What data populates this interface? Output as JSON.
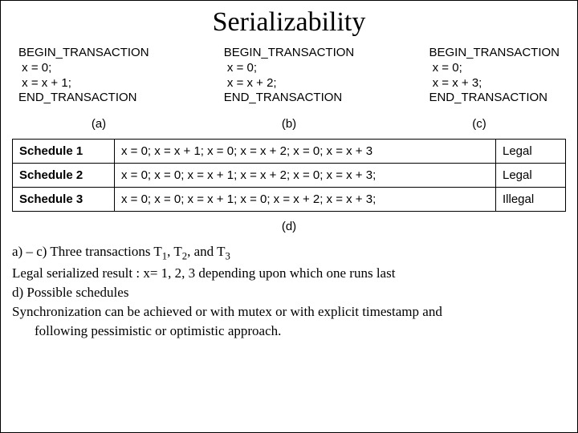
{
  "title": "Serializability",
  "transactions": {
    "a": "BEGIN_TRANSACTION\n x = 0;\n x = x + 1;\nEND_TRANSACTION",
    "b": "BEGIN_TRANSACTION\n x = 0;\n x = x + 2;\nEND_TRANSACTION",
    "c": "BEGIN_TRANSACTION\n x = 0;\n x = x + 3;\nEND_TRANSACTION"
  },
  "labels": {
    "a": "(a)",
    "b": "(b)",
    "c": "(c)",
    "d": "(d)"
  },
  "schedules": [
    {
      "name": "Schedule 1",
      "ops": "x = 0;  x = x + 1;  x = 0;  x = x + 2;  x = 0;  x = x + 3",
      "verdict": "Legal"
    },
    {
      "name": "Schedule 2",
      "ops": "x = 0;   x = 0;  x = x + 1;  x = x + 2;  x = 0;  x = x + 3;",
      "verdict": "Legal"
    },
    {
      "name": "Schedule 3",
      "ops": "x = 0;  x = 0;  x = x + 1;  x = 0;  x = x + 2;  x = x + 3;",
      "verdict": "Illegal"
    }
  ],
  "notes": {
    "line1_pre": "a) – c) Three transactions T",
    "line1_mid1": ", T",
    "line1_mid2": ", and T",
    "sub1": "1",
    "sub2": "2",
    "sub3": "3",
    "line2": "Legal serialized result : x= 1, 2, 3 depending upon which one runs last",
    "line3": "d) Possible schedules",
    "line4": "Synchronization can be achieved or with mutex or with explicit timestamp and",
    "line5": "following pessimistic or optimistic approach."
  }
}
